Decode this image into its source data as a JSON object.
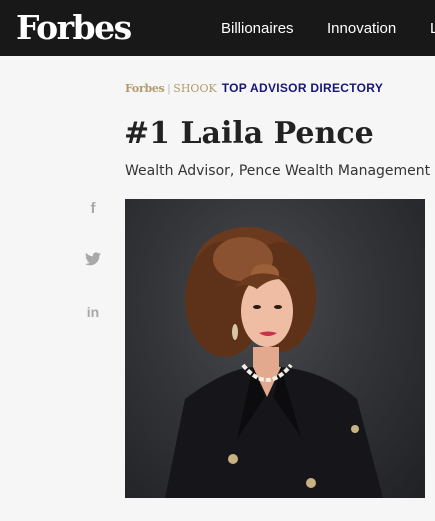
{
  "header": {
    "logo": "Forbes",
    "nav": [
      "Billionaires",
      "Innovation",
      "L"
    ]
  },
  "breadcrumb": {
    "forbes": "Forbes",
    "separator": "|",
    "shook": "SHOOK",
    "directory": "TOP ADVISOR DIRECTORY"
  },
  "profile": {
    "title": "#1 Laila Pence",
    "subtitle": "Wealth Advisor, Pence Wealth Management"
  },
  "social": {
    "facebook": "f",
    "twitter_icon": "twitter-icon",
    "linkedin": "in"
  },
  "colors": {
    "header_bg": "#181818",
    "directory_blue": "#15157a",
    "forbes_gold": "#b39a6b",
    "page_bg": "#f6f6f6"
  }
}
